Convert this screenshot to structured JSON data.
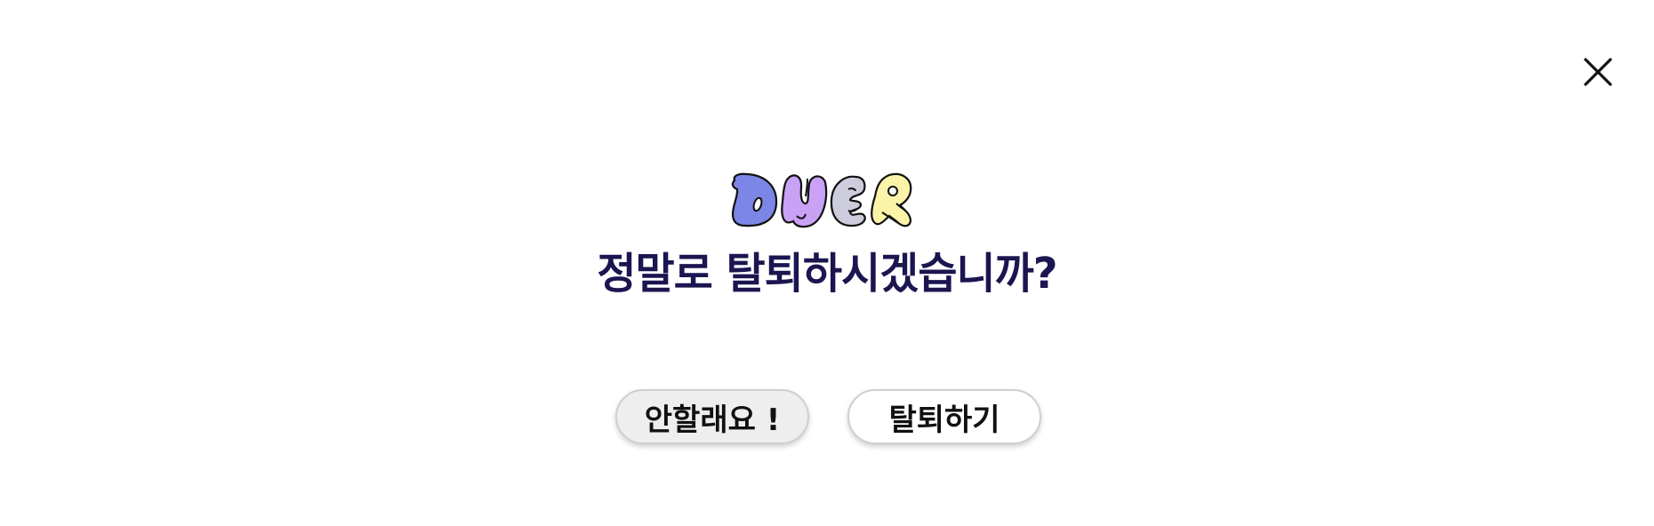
{
  "dialog": {
    "brand_name": "DUER",
    "title": "정말로 탈퇴하시겠습니까?",
    "cancel_label": "안할래요 !",
    "confirm_label": "탈퇴하기",
    "close_icon": "close-icon"
  },
  "colors": {
    "title": "#1b1550",
    "logo_d": "#7b86e6",
    "logo_u": "#c9a1f5",
    "logo_e": "#ccccdc",
    "logo_r": "#fbf3a8",
    "cancel_bg": "#eeeeee",
    "confirm_bg": "#ffffff"
  }
}
